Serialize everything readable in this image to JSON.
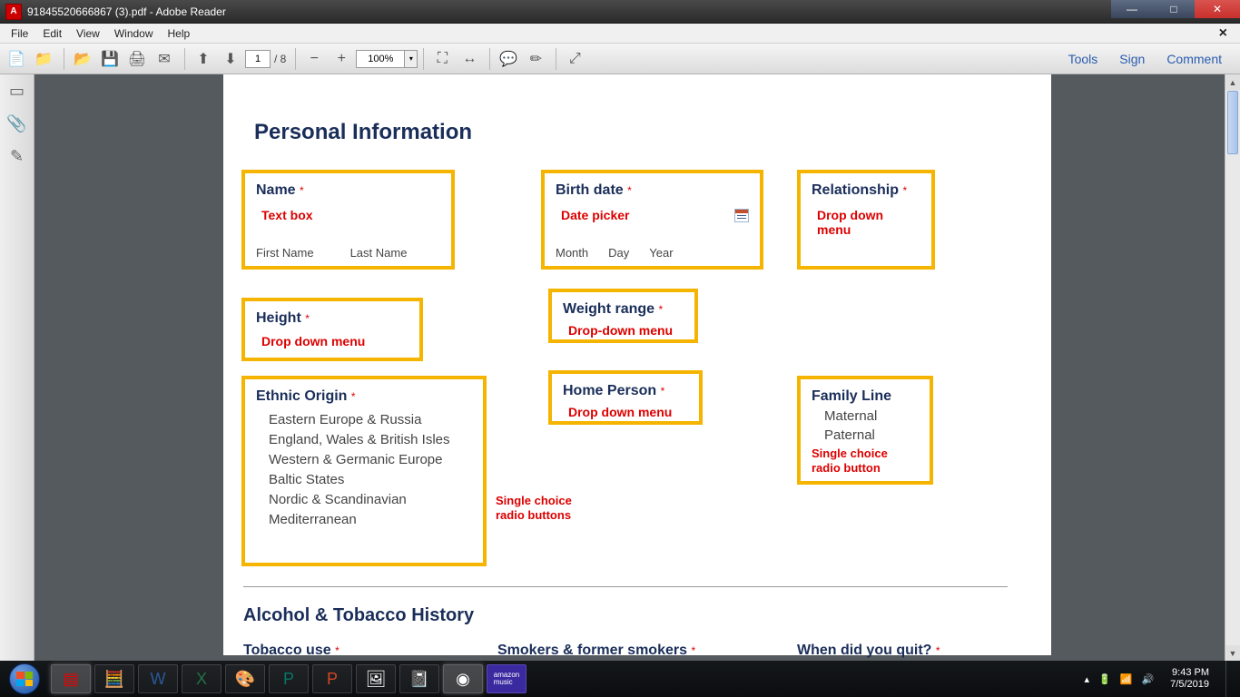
{
  "window": {
    "title": "91845520666867 (3).pdf - Adobe Reader",
    "app_glyph": "A"
  },
  "menu": {
    "file": "File",
    "edit": "Edit",
    "view": "View",
    "window": "Window",
    "help": "Help"
  },
  "toolbar": {
    "page_current": "1",
    "page_total": "/ 8",
    "zoom": "100%",
    "tools": "Tools",
    "sign": "Sign",
    "comment": "Comment"
  },
  "doc": {
    "h_personal": "Personal Information",
    "name": {
      "label": "Name ",
      "annot": "Text box",
      "first": "First Name",
      "last": "Last Name"
    },
    "birth": {
      "label": "Birth date ",
      "annot": "Date picker",
      "month": "Month",
      "day": "Day",
      "year": "Year"
    },
    "rel": {
      "label": "Relationship ",
      "annot": "Drop down menu"
    },
    "height": {
      "label": "Height ",
      "annot": "Drop down menu"
    },
    "weight": {
      "label": "Weight range ",
      "annot": "Drop-down menu"
    },
    "ethnic": {
      "label": "Ethnic Origin ",
      "opts": [
        "Eastern Europe & Russia",
        "England, Wales & British Isles",
        "Western & Germanic Europe",
        "Baltic States",
        "Nordic & Scandinavian",
        "Mediterranean"
      ],
      "annot1": "Single choice",
      "annot2": "radio buttons"
    },
    "home": {
      "label": "Home Person ",
      "annot": "Drop down menu"
    },
    "family": {
      "label": "Family Line",
      "opts": [
        "Maternal",
        "Paternal"
      ],
      "annot1": "Single choice",
      "annot2": "radio button"
    },
    "h_alcohol": "Alcohol & Tobacco History",
    "tobacco": "Tobacco use ",
    "smokers": "Smokers & former smokers ",
    "quit": "When did you quit? ",
    "star": "*"
  },
  "systray": {
    "time": "9:43 PM",
    "date": "7/5/2019"
  }
}
